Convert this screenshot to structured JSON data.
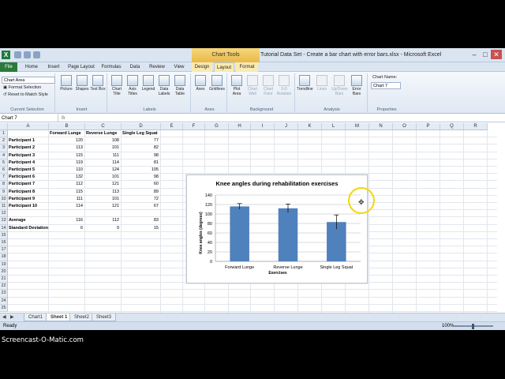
{
  "window": {
    "doc_title": "Tutorial Data Set - Create a bar chart with error bars.xlsx - Microsoft Excel",
    "contextual_tab": "Chart Tools"
  },
  "tabs": [
    {
      "label": "File",
      "active": false
    },
    {
      "label": "Home"
    },
    {
      "label": "Insert"
    },
    {
      "label": "Page Layout"
    },
    {
      "label": "Formulas"
    },
    {
      "label": "Data"
    },
    {
      "label": "Review"
    },
    {
      "label": "View"
    },
    {
      "label": "Design"
    },
    {
      "label": "Layout",
      "active": true
    },
    {
      "label": "Format"
    }
  ],
  "ribbon": {
    "current_selection": {
      "dropdown_value": "Chart Area",
      "format_selection": "Format Selection",
      "reset_style": "Reset to Match Style",
      "group_label": "Current Selection"
    },
    "insert_group": {
      "label": "Insert",
      "buttons": [
        "Picture",
        "Shapes",
        "Text Box"
      ]
    },
    "labels_group": {
      "label": "Labels",
      "buttons": [
        "Chart Title",
        "Axis Titles",
        "Legend",
        "Data Labels",
        "Data Table"
      ]
    },
    "axes_group": {
      "label": "Axes",
      "buttons": [
        "Axes",
        "Gridlines"
      ]
    },
    "background_group": {
      "label": "Background",
      "buttons": [
        "Plot Area",
        "Chart Wall",
        "Chart Floor",
        "3-D Rotation"
      ]
    },
    "analysis_group": {
      "label": "Analysis",
      "buttons": [
        "Trendline",
        "Lines",
        "Up/Down Bars",
        "Error Bars"
      ]
    },
    "properties_group": {
      "label": "Properties",
      "chart_name_label": "Chart Name:",
      "chart_name_value": "Chart 7"
    }
  },
  "formula_bar": {
    "name_box": "Chart 7",
    "fx": "fx"
  },
  "grid": {
    "columns": [
      "A",
      "B",
      "C",
      "D",
      "E",
      "F",
      "G",
      "H",
      "I",
      "J",
      "K",
      "L",
      "M",
      "N",
      "O",
      "P",
      "Q",
      "R"
    ],
    "rows": [
      "1",
      "2",
      "3",
      "4",
      "5",
      "6",
      "7",
      "8",
      "9",
      "10",
      "11",
      "12",
      "13",
      "14",
      "15",
      "16",
      "17",
      "18",
      "19",
      "20",
      "21",
      "22",
      "23",
      "24",
      "25"
    ],
    "headers": [
      "",
      "Forward Lunge",
      "Reverse Lunge",
      "Single Leg Squat"
    ],
    "participants": [
      {
        "name": "Participant 1",
        "values": [
          "120",
          "108",
          "77"
        ]
      },
      {
        "name": "Participant 2",
        "values": [
          "113",
          "101",
          "82"
        ]
      },
      {
        "name": "Participant 3",
        "values": [
          "115",
          "111",
          "98"
        ]
      },
      {
        "name": "Participant 4",
        "values": [
          "119",
          "114",
          "81"
        ]
      },
      {
        "name": "Participant 5",
        "values": [
          "110",
          "124",
          "105"
        ]
      },
      {
        "name": "Participant 6",
        "values": [
          "132",
          "101",
          "98"
        ]
      },
      {
        "name": "Participant 7",
        "values": [
          "112",
          "121",
          "60"
        ]
      },
      {
        "name": "Participant 8",
        "values": [
          "115",
          "113",
          "89"
        ]
      },
      {
        "name": "Participant 9",
        "values": [
          "111",
          "101",
          "72"
        ]
      },
      {
        "name": "Participant 10",
        "values": [
          "114",
          "121",
          "67"
        ]
      }
    ],
    "average": {
      "label": "Average",
      "values": [
        "116",
        "112",
        "83"
      ]
    },
    "stdev": {
      "label": "Standard Deviation",
      "values": [
        "6",
        "9",
        "15"
      ]
    }
  },
  "chart_data": {
    "type": "bar",
    "title": "Knee angles during rehabilitation exercises",
    "xlabel": "Exercises",
    "ylabel": "Knee angles  (degrees)",
    "categories": [
      "Forward Lunge",
      "Reverse Lunge",
      "Single Leg Squat"
    ],
    "values": [
      116,
      112,
      83
    ],
    "error_bars": [
      6,
      9,
      15
    ],
    "ylim": [
      0,
      140
    ],
    "yticks": [
      0,
      20,
      40,
      60,
      80,
      100,
      120,
      140
    ],
    "grid": true,
    "bar_color": "#4f81bd"
  },
  "sheets": [
    {
      "label": "Chart1"
    },
    {
      "label": "Sheet 1",
      "active": true
    },
    {
      "label": "Sheet2"
    },
    {
      "label": "Sheet3"
    }
  ],
  "status": {
    "ready": "Ready",
    "zoom": "100%"
  },
  "watermark": "Screencast-O-Matic.com"
}
